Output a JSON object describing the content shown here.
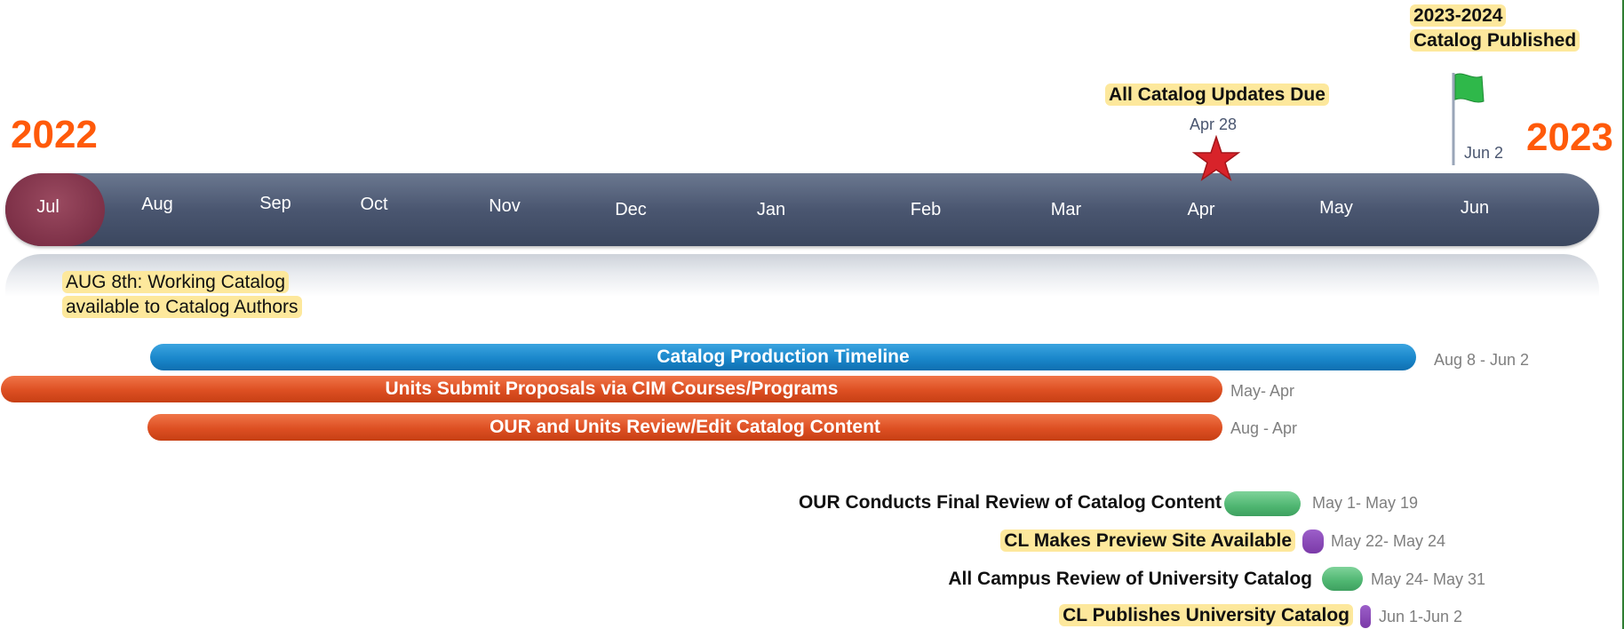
{
  "chart_data": {
    "type": "timeline",
    "years": {
      "start": "2022",
      "end": "2023"
    },
    "months": [
      "Jul",
      "Aug",
      "Sep",
      "Oct",
      "Nov",
      "Dec",
      "Jan",
      "Feb",
      "Mar",
      "Apr",
      "May",
      "Jun"
    ],
    "milestones": [
      {
        "id": "apr28",
        "label": "All Catalog Updates Due",
        "date": "Apr 28",
        "marker": "star-icon",
        "color": "#d32f2f"
      },
      {
        "id": "jun2",
        "label_line1": "2023-2024",
        "label_line2": "Catalog Published",
        "date": "Jun 2",
        "marker": "flag-icon",
        "color": "#2fb84a"
      }
    ],
    "callout": {
      "line1": "AUG 8th: Working Catalog",
      "line2": "available to Catalog Authors"
    },
    "bars": [
      {
        "label": "Catalog Production Timeline",
        "range": "Aug 8 - Jun 2",
        "color": "#1a87cb"
      },
      {
        "label": "Units Submit Proposals via CIM Courses/Programs",
        "range": "May- Apr",
        "color": "#dd4f22"
      },
      {
        "label": "OUR and Units Review/Edit Catalog Content",
        "range": "Aug - Apr",
        "color": "#dd4f22"
      }
    ],
    "tasks": [
      {
        "label": "OUR Conducts Final Review of Catalog Content",
        "range": "May 1- May 19",
        "color": "#4fb671",
        "highlight": false
      },
      {
        "label": "CL Makes Preview Site Available",
        "range": "May 22- May 24",
        "color": "#7b3aa8",
        "highlight": true
      },
      {
        "label": "All Campus Review of University Catalog",
        "range": "May 24- May 31",
        "color": "#4fb671",
        "highlight": false
      },
      {
        "label": "CL Publishes University Catalog",
        "range": "Jun 1-Jun 2",
        "color": "#7b3aa8",
        "highlight": true
      }
    ]
  }
}
